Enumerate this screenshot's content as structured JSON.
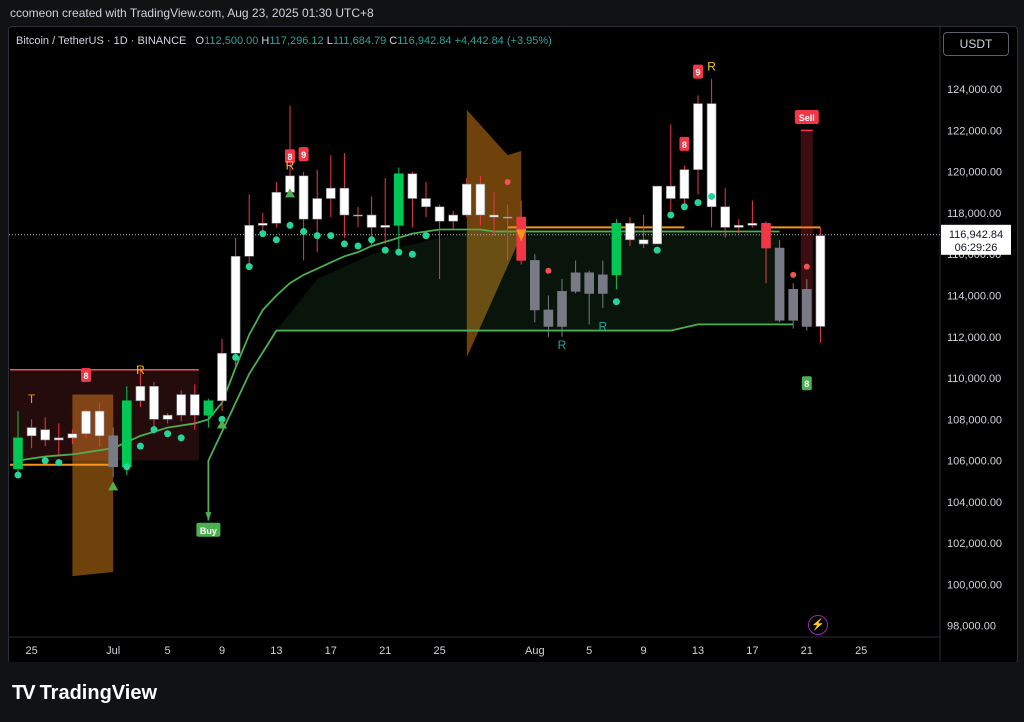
{
  "credit": "ccomeon created with TradingView.com, Aug 23, 2025 01:30 UTC+8",
  "legend": {
    "symbol": "Bitcoin / TetherUS · 1D · BINANCE",
    "o_label": "O",
    "o": "112,500.00",
    "h_label": "H",
    "h": "117,296.12",
    "l_label": "L",
    "l": "111,684.79",
    "c_label": "C",
    "c": "116,942.84",
    "change": "+4,442.84 (+3.95%)"
  },
  "currency_button": "USDT",
  "brand": {
    "logo": "TV",
    "name": "TradingView"
  },
  "colors": {
    "up_candle": "#ffffff",
    "down_candle": "#f23645",
    "neutral_candle": "#787b86",
    "green_candle": "#00c853",
    "accent_green": "#4caf50",
    "orange": "#f7931a",
    "dot_green": "#26d49a",
    "dot_red": "#ef5350",
    "sell": "#f23645",
    "buy": "#4caf50",
    "r_yellow": "#f5c518",
    "r_teal": "#26a69a"
  },
  "chart_data": {
    "type": "candlestick",
    "ylim": [
      97500,
      125800
    ],
    "y_ticks": [
      "124,000.00",
      "122,000.00",
      "120,000.00",
      "118,000.00",
      "116,000.00",
      "114,000.00",
      "112,000.00",
      "110,000.00",
      "108,000.00",
      "106,000.00",
      "104,000.00",
      "102,000.00",
      "100,000.00",
      "98,000.00"
    ],
    "x_ticks": [
      "25",
      "Jul",
      "5",
      "9",
      "13",
      "17",
      "21",
      "25",
      "Aug",
      "5",
      "9",
      "13",
      "17",
      "21",
      "25"
    ],
    "last_price": "116,942.84",
    "countdown": "06:29:26",
    "candles": [
      {
        "d": "Jun 24",
        "o": 105600,
        "h": 108400,
        "l": 105200,
        "c": 107100,
        "col": "green"
      },
      {
        "d": "Jun 25",
        "o": 107200,
        "h": 108000,
        "l": 106600,
        "c": 107600,
        "col": "up"
      },
      {
        "d": "Jun 26",
        "o": 107500,
        "h": 108100,
        "l": 106700,
        "c": 107000,
        "col": "up"
      },
      {
        "d": "Jun 27",
        "o": 107000,
        "h": 107800,
        "l": 106300,
        "c": 107100,
        "col": "up"
      },
      {
        "d": "Jun 28",
        "o": 107100,
        "h": 107500,
        "l": 106800,
        "c": 107300,
        "col": "up"
      },
      {
        "d": "Jun 29",
        "o": 107300,
        "h": 108500,
        "l": 107100,
        "c": 108400,
        "col": "up"
      },
      {
        "d": "Jun 30",
        "o": 108400,
        "h": 108800,
        "l": 106700,
        "c": 107200,
        "col": "up"
      },
      {
        "d": "Jul 1",
        "o": 107200,
        "h": 107600,
        "l": 105200,
        "c": 105700,
        "col": "grey"
      },
      {
        "d": "Jul 2",
        "o": 105700,
        "h": 109600,
        "l": 105300,
        "c": 108900,
        "col": "green"
      },
      {
        "d": "Jul 3",
        "o": 108900,
        "h": 110500,
        "l": 108600,
        "c": 109600,
        "col": "up"
      },
      {
        "d": "Jul 4",
        "o": 109600,
        "h": 109800,
        "l": 107300,
        "c": 108000,
        "col": "up"
      },
      {
        "d": "Jul 5",
        "o": 108000,
        "h": 108300,
        "l": 107800,
        "c": 108200,
        "col": "up"
      },
      {
        "d": "Jul 6",
        "o": 108200,
        "h": 109400,
        "l": 107900,
        "c": 109200,
        "col": "up"
      },
      {
        "d": "Jul 7",
        "o": 109200,
        "h": 109700,
        "l": 107500,
        "c": 108200,
        "col": "up"
      },
      {
        "d": "Jul 8",
        "o": 108200,
        "h": 109000,
        "l": 107600,
        "c": 108900,
        "col": "green"
      },
      {
        "d": "Jul 9",
        "o": 108900,
        "h": 111900,
        "l": 108400,
        "c": 111200,
        "col": "up"
      },
      {
        "d": "Jul 10",
        "o": 111200,
        "h": 116800,
        "l": 110600,
        "c": 115900,
        "col": "up"
      },
      {
        "d": "Jul 11",
        "o": 115900,
        "h": 118900,
        "l": 115500,
        "c": 117400,
        "col": "up"
      },
      {
        "d": "Jul 12",
        "o": 117400,
        "h": 118000,
        "l": 116900,
        "c": 117500,
        "col": "up"
      },
      {
        "d": "Jul 13",
        "o": 117500,
        "h": 119500,
        "l": 117300,
        "c": 119000,
        "col": "up"
      },
      {
        "d": "Jul 14",
        "o": 119000,
        "h": 123200,
        "l": 118900,
        "c": 119800,
        "col": "up"
      },
      {
        "d": "Jul 15",
        "o": 119800,
        "h": 120000,
        "l": 115700,
        "c": 117700,
        "col": "up"
      },
      {
        "d": "Jul 16",
        "o": 117700,
        "h": 120100,
        "l": 116100,
        "c": 118700,
        "col": "up"
      },
      {
        "d": "Jul 17",
        "o": 118700,
        "h": 120800,
        "l": 117800,
        "c": 119200,
        "col": "up"
      },
      {
        "d": "Jul 18",
        "o": 119200,
        "h": 120900,
        "l": 116800,
        "c": 117900,
        "col": "up"
      },
      {
        "d": "Jul 19",
        "o": 117900,
        "h": 118300,
        "l": 117300,
        "c": 117900,
        "col": "up"
      },
      {
        "d": "Jul 20",
        "o": 117900,
        "h": 118800,
        "l": 116400,
        "c": 117300,
        "col": "up"
      },
      {
        "d": "Jul 21",
        "o": 117300,
        "h": 119700,
        "l": 116500,
        "c": 117400,
        "col": "up"
      },
      {
        "d": "Jul 22",
        "o": 117400,
        "h": 120200,
        "l": 116100,
        "c": 119900,
        "col": "green"
      },
      {
        "d": "Jul 23",
        "o": 119900,
        "h": 120000,
        "l": 117300,
        "c": 118700,
        "col": "up"
      },
      {
        "d": "Jul 24",
        "o": 118700,
        "h": 119500,
        "l": 117800,
        "c": 118300,
        "col": "up"
      },
      {
        "d": "Jul 25",
        "o": 118300,
        "h": 118400,
        "l": 114800,
        "c": 117600,
        "col": "up"
      },
      {
        "d": "Jul 26",
        "o": 117600,
        "h": 118100,
        "l": 117200,
        "c": 117900,
        "col": "up"
      },
      {
        "d": "Jul 27",
        "o": 117900,
        "h": 119700,
        "l": 117800,
        "c": 119400,
        "col": "up"
      },
      {
        "d": "Jul 28",
        "o": 119400,
        "h": 119800,
        "l": 117400,
        "c": 117900,
        "col": "up"
      },
      {
        "d": "Jul 29",
        "o": 117900,
        "h": 119000,
        "l": 116900,
        "c": 117800,
        "col": "up"
      },
      {
        "d": "Jul 30",
        "o": 117800,
        "h": 118400,
        "l": 115700,
        "c": 117800,
        "col": "up"
      },
      {
        "d": "Jul 31",
        "o": 117800,
        "h": 118600,
        "l": 115500,
        "c": 115700,
        "col": "red"
      },
      {
        "d": "Aug 1",
        "o": 115700,
        "h": 116000,
        "l": 112700,
        "c": 113300,
        "col": "grey"
      },
      {
        "d": "Aug 2",
        "o": 113300,
        "h": 114000,
        "l": 112000,
        "c": 112500,
        "col": "grey"
      },
      {
        "d": "Aug 3",
        "o": 112500,
        "h": 114800,
        "l": 112000,
        "c": 114200,
        "col": "grey"
      },
      {
        "d": "Aug 4",
        "o": 114200,
        "h": 115700,
        "l": 114100,
        "c": 115100,
        "col": "grey"
      },
      {
        "d": "Aug 5",
        "o": 115100,
        "h": 115200,
        "l": 112600,
        "c": 114100,
        "col": "grey"
      },
      {
        "d": "Aug 6",
        "o": 114100,
        "h": 115700,
        "l": 113400,
        "c": 115000,
        "col": "grey"
      },
      {
        "d": "Aug 7",
        "o": 115000,
        "h": 117700,
        "l": 114300,
        "c": 117500,
        "col": "green"
      },
      {
        "d": "Aug 8",
        "o": 117500,
        "h": 117800,
        "l": 116400,
        "c": 116700,
        "col": "up"
      },
      {
        "d": "Aug 9",
        "o": 116700,
        "h": 117900,
        "l": 116300,
        "c": 116500,
        "col": "up"
      },
      {
        "d": "Aug 10",
        "o": 116500,
        "h": 119300,
        "l": 116500,
        "c": 119300,
        "col": "up"
      },
      {
        "d": "Aug 11",
        "o": 119300,
        "h": 122300,
        "l": 118100,
        "c": 118700,
        "col": "up"
      },
      {
        "d": "Aug 12",
        "o": 118700,
        "h": 120300,
        "l": 118200,
        "c": 120100,
        "col": "up"
      },
      {
        "d": "Aug 13",
        "o": 120100,
        "h": 123700,
        "l": 118900,
        "c": 123300,
        "col": "up"
      },
      {
        "d": "Aug 14",
        "o": 123300,
        "h": 124500,
        "l": 117300,
        "c": 118300,
        "col": "up"
      },
      {
        "d": "Aug 15",
        "o": 118300,
        "h": 119200,
        "l": 116800,
        "c": 117300,
        "col": "up"
      },
      {
        "d": "Aug 16",
        "o": 117300,
        "h": 117700,
        "l": 117000,
        "c": 117400,
        "col": "up"
      },
      {
        "d": "Aug 17",
        "o": 117400,
        "h": 118600,
        "l": 117300,
        "c": 117500,
        "col": "up"
      },
      {
        "d": "Aug 18",
        "o": 117500,
        "h": 117600,
        "l": 114600,
        "c": 116300,
        "col": "red"
      },
      {
        "d": "Aug 19",
        "o": 116300,
        "h": 116700,
        "l": 112700,
        "c": 112800,
        "col": "grey"
      },
      {
        "d": "Aug 20",
        "o": 112800,
        "h": 114600,
        "l": 112400,
        "c": 114300,
        "col": "grey"
      },
      {
        "d": "Aug 21",
        "o": 114300,
        "h": 114800,
        "l": 112300,
        "c": 112500,
        "col": "grey"
      },
      {
        "d": "Aug 22",
        "o": 112500,
        "h": 117300,
        "l": 111700,
        "c": 116900,
        "col": "up"
      }
    ],
    "labels": {
      "buy": "Buy",
      "sell": "Sell",
      "nine_a": "9",
      "nine_b": "9",
      "eight_a": "8",
      "eight_b": "8",
      "eight_c": "8",
      "eight_d": "8",
      "r": "R",
      "t": "T"
    }
  }
}
